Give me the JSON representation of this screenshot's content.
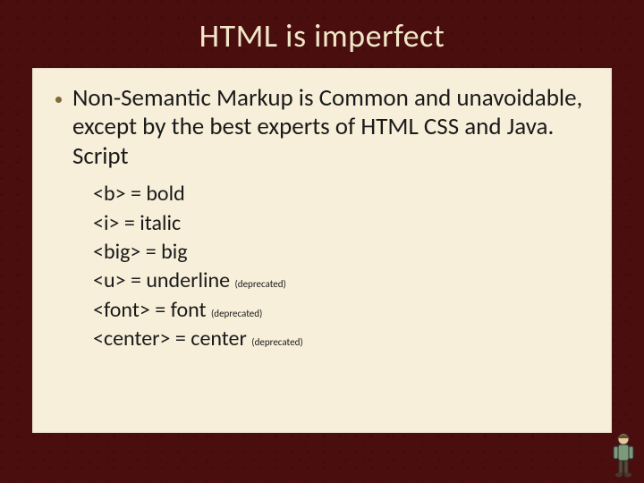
{
  "title": "HTML is imperfect",
  "bullet": "Non-Semantic Markup is Common and unavoidable, except by the best experts of HTML CSS and Java. Script",
  "items": [
    {
      "tag": "<b>",
      "label": " = bold",
      "dep": ""
    },
    {
      "tag": "<i>",
      "label": " = italic",
      "dep": ""
    },
    {
      "tag": "<big>",
      "label": " = big",
      "dep": ""
    },
    {
      "tag": "<u>",
      "label": " = underline ",
      "dep": "(deprecated)"
    },
    {
      "tag": "<font>",
      "label": " = font ",
      "dep": "(deprecated)"
    },
    {
      "tag": "<center>",
      "label": " = center ",
      "dep": "(deprecated)"
    }
  ]
}
